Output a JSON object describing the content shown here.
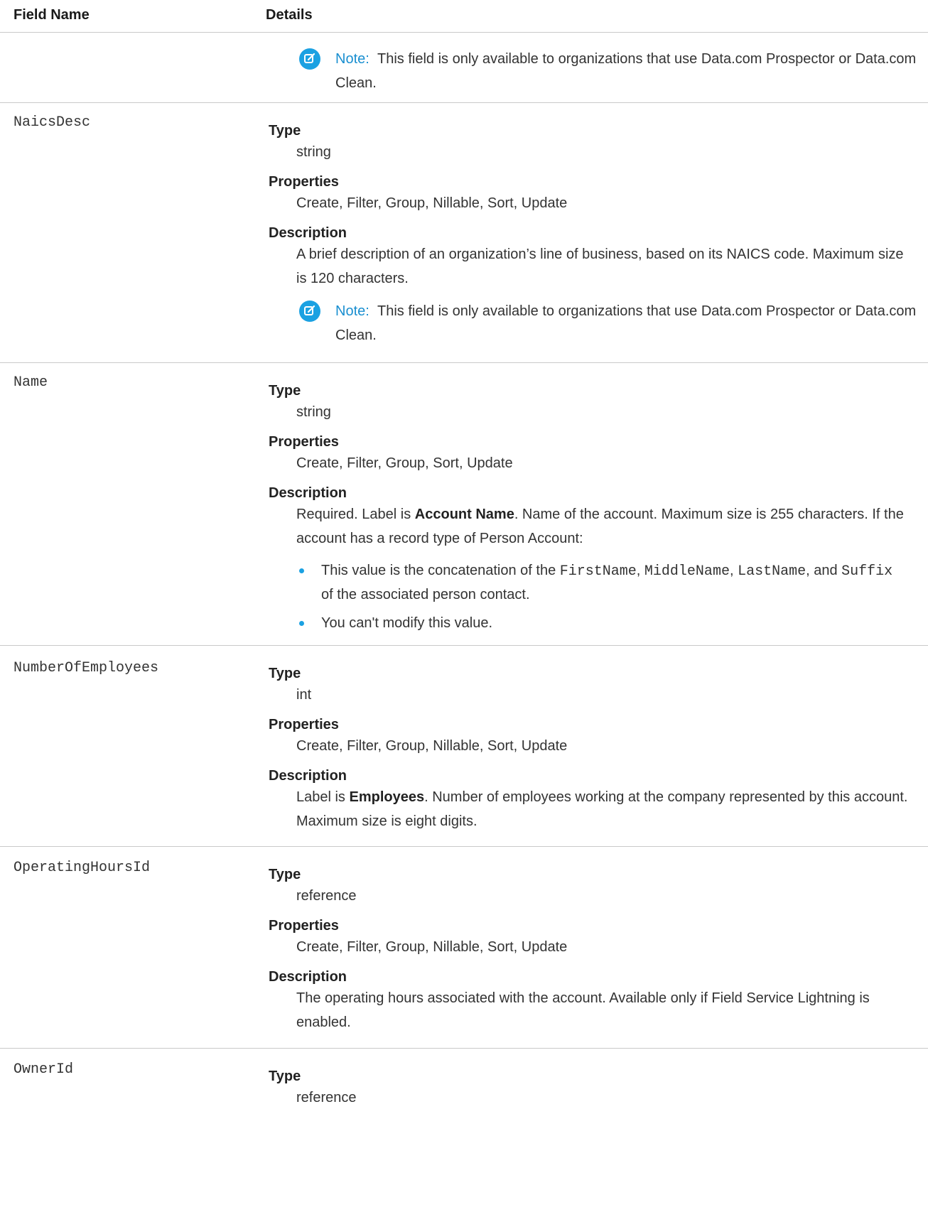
{
  "header": {
    "field_name": "Field Name",
    "details": "Details"
  },
  "labels": {
    "type": "Type",
    "properties": "Properties",
    "description": "Description",
    "note": "Note:"
  },
  "top_note": "This field is only available to organizations that use Data.com Prospector or Data.com Clean.",
  "rows": [
    {
      "name": "NaicsDesc",
      "type": "string",
      "properties": "Create, Filter, Group, Nillable, Sort, Update",
      "description": "A brief description of an organization’s line of business, based on its NAICS code. Maximum size is 120 characters.",
      "note": "This field is only available to organizations that use Data.com Prospector or Data.com Clean."
    },
    {
      "name": "Name",
      "type": "string",
      "properties": "Create, Filter, Group, Sort, Update",
      "description_pre": "Required. Label is ",
      "description_bold": "Account Name",
      "description_post": ". Name of the account. Maximum size is 255 characters. If the account has a record type of Person Account:",
      "bullet1_pre": "This value is the concatenation of the ",
      "bullet1_code1": "FirstName",
      "bullet1_sep1": ", ",
      "bullet1_code2": "MiddleName",
      "bullet1_sep2": ", ",
      "bullet1_code3": "LastName",
      "bullet1_sep3": ", and ",
      "bullet1_code4": "Suffix",
      "bullet1_post": " of the associated person contact.",
      "bullet2": "You can't modify this value."
    },
    {
      "name": "NumberOfEmployees",
      "type": "int",
      "properties": "Create, Filter, Group, Nillable, Sort, Update",
      "description_pre": "Label is ",
      "description_bold": "Employees",
      "description_post": ". Number of employees working at the company represented by this account. Maximum size is eight digits."
    },
    {
      "name": "OperatingHoursId",
      "type": "reference",
      "properties": "Create, Filter, Group, Nillable, Sort, Update",
      "description": "The operating hours associated with the account. Available only if Field Service Lightning is enabled."
    },
    {
      "name": "OwnerId",
      "type": "reference"
    }
  ]
}
